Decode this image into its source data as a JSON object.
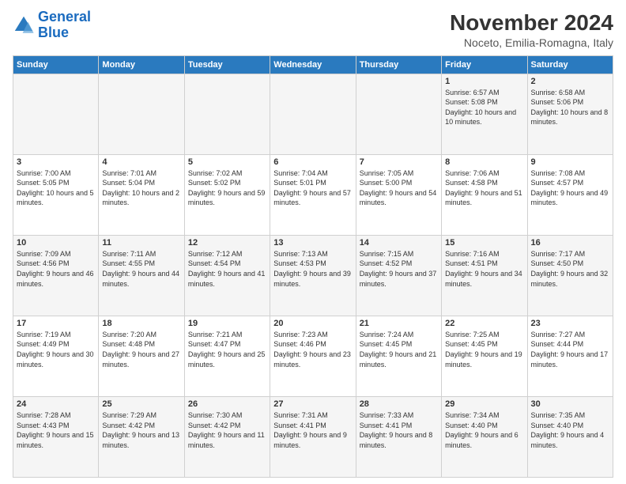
{
  "logo": {
    "line1": "General",
    "line2": "Blue"
  },
  "title": "November 2024",
  "subtitle": "Noceto, Emilia-Romagna, Italy",
  "headers": [
    "Sunday",
    "Monday",
    "Tuesday",
    "Wednesday",
    "Thursday",
    "Friday",
    "Saturday"
  ],
  "weeks": [
    [
      {
        "day": "",
        "info": ""
      },
      {
        "day": "",
        "info": ""
      },
      {
        "day": "",
        "info": ""
      },
      {
        "day": "",
        "info": ""
      },
      {
        "day": "",
        "info": ""
      },
      {
        "day": "1",
        "info": "Sunrise: 6:57 AM\nSunset: 5:08 PM\nDaylight: 10 hours and 10 minutes."
      },
      {
        "day": "2",
        "info": "Sunrise: 6:58 AM\nSunset: 5:06 PM\nDaylight: 10 hours and 8 minutes."
      }
    ],
    [
      {
        "day": "3",
        "info": "Sunrise: 7:00 AM\nSunset: 5:05 PM\nDaylight: 10 hours and 5 minutes."
      },
      {
        "day": "4",
        "info": "Sunrise: 7:01 AM\nSunset: 5:04 PM\nDaylight: 10 hours and 2 minutes."
      },
      {
        "day": "5",
        "info": "Sunrise: 7:02 AM\nSunset: 5:02 PM\nDaylight: 9 hours and 59 minutes."
      },
      {
        "day": "6",
        "info": "Sunrise: 7:04 AM\nSunset: 5:01 PM\nDaylight: 9 hours and 57 minutes."
      },
      {
        "day": "7",
        "info": "Sunrise: 7:05 AM\nSunset: 5:00 PM\nDaylight: 9 hours and 54 minutes."
      },
      {
        "day": "8",
        "info": "Sunrise: 7:06 AM\nSunset: 4:58 PM\nDaylight: 9 hours and 51 minutes."
      },
      {
        "day": "9",
        "info": "Sunrise: 7:08 AM\nSunset: 4:57 PM\nDaylight: 9 hours and 49 minutes."
      }
    ],
    [
      {
        "day": "10",
        "info": "Sunrise: 7:09 AM\nSunset: 4:56 PM\nDaylight: 9 hours and 46 minutes."
      },
      {
        "day": "11",
        "info": "Sunrise: 7:11 AM\nSunset: 4:55 PM\nDaylight: 9 hours and 44 minutes."
      },
      {
        "day": "12",
        "info": "Sunrise: 7:12 AM\nSunset: 4:54 PM\nDaylight: 9 hours and 41 minutes."
      },
      {
        "day": "13",
        "info": "Sunrise: 7:13 AM\nSunset: 4:53 PM\nDaylight: 9 hours and 39 minutes."
      },
      {
        "day": "14",
        "info": "Sunrise: 7:15 AM\nSunset: 4:52 PM\nDaylight: 9 hours and 37 minutes."
      },
      {
        "day": "15",
        "info": "Sunrise: 7:16 AM\nSunset: 4:51 PM\nDaylight: 9 hours and 34 minutes."
      },
      {
        "day": "16",
        "info": "Sunrise: 7:17 AM\nSunset: 4:50 PM\nDaylight: 9 hours and 32 minutes."
      }
    ],
    [
      {
        "day": "17",
        "info": "Sunrise: 7:19 AM\nSunset: 4:49 PM\nDaylight: 9 hours and 30 minutes."
      },
      {
        "day": "18",
        "info": "Sunrise: 7:20 AM\nSunset: 4:48 PM\nDaylight: 9 hours and 27 minutes."
      },
      {
        "day": "19",
        "info": "Sunrise: 7:21 AM\nSunset: 4:47 PM\nDaylight: 9 hours and 25 minutes."
      },
      {
        "day": "20",
        "info": "Sunrise: 7:23 AM\nSunset: 4:46 PM\nDaylight: 9 hours and 23 minutes."
      },
      {
        "day": "21",
        "info": "Sunrise: 7:24 AM\nSunset: 4:45 PM\nDaylight: 9 hours and 21 minutes."
      },
      {
        "day": "22",
        "info": "Sunrise: 7:25 AM\nSunset: 4:45 PM\nDaylight: 9 hours and 19 minutes."
      },
      {
        "day": "23",
        "info": "Sunrise: 7:27 AM\nSunset: 4:44 PM\nDaylight: 9 hours and 17 minutes."
      }
    ],
    [
      {
        "day": "24",
        "info": "Sunrise: 7:28 AM\nSunset: 4:43 PM\nDaylight: 9 hours and 15 minutes."
      },
      {
        "day": "25",
        "info": "Sunrise: 7:29 AM\nSunset: 4:42 PM\nDaylight: 9 hours and 13 minutes."
      },
      {
        "day": "26",
        "info": "Sunrise: 7:30 AM\nSunset: 4:42 PM\nDaylight: 9 hours and 11 minutes."
      },
      {
        "day": "27",
        "info": "Sunrise: 7:31 AM\nSunset: 4:41 PM\nDaylight: 9 hours and 9 minutes."
      },
      {
        "day": "28",
        "info": "Sunrise: 7:33 AM\nSunset: 4:41 PM\nDaylight: 9 hours and 8 minutes."
      },
      {
        "day": "29",
        "info": "Sunrise: 7:34 AM\nSunset: 4:40 PM\nDaylight: 9 hours and 6 minutes."
      },
      {
        "day": "30",
        "info": "Sunrise: 7:35 AM\nSunset: 4:40 PM\nDaylight: 9 hours and 4 minutes."
      }
    ]
  ]
}
